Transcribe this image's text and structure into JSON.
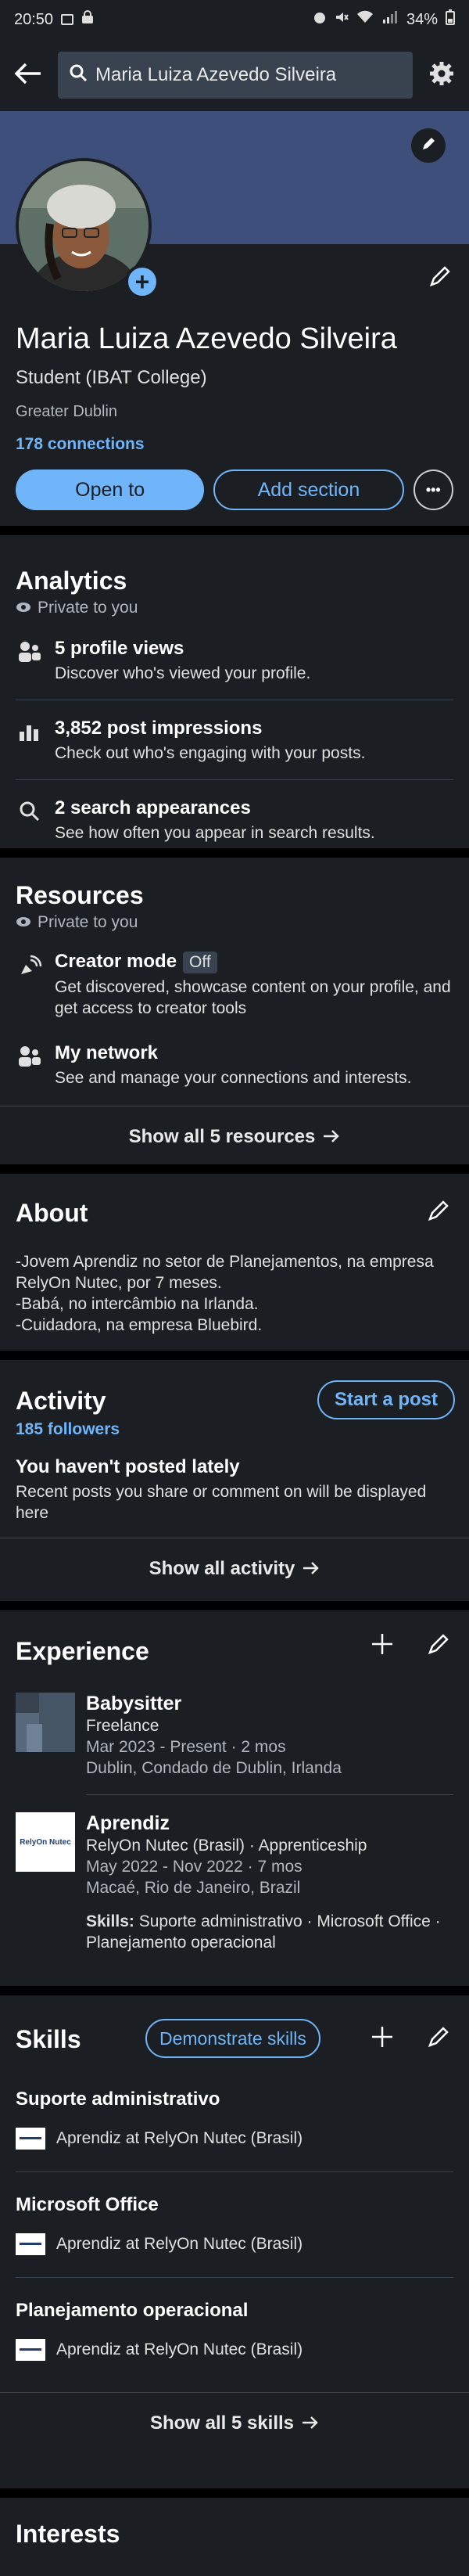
{
  "status_bar": {
    "time": "20:50",
    "battery": "34%"
  },
  "search": {
    "value": "Maria Luiza Azevedo Silveira"
  },
  "profile": {
    "name": "Maria Luiza Azevedo Silveira",
    "headline": "Student (IBAT College)",
    "location": "Greater Dublin",
    "connections": "178 connections",
    "open_to_label": "Open to",
    "add_section_label": "Add section",
    "more_label": "•••"
  },
  "analytics": {
    "title": "Analytics",
    "private": "Private to you",
    "items": [
      {
        "title": "5 profile views",
        "desc": "Discover who's viewed your profile."
      },
      {
        "title": "3,852 post impressions",
        "desc": "Check out who's engaging with your posts."
      },
      {
        "title": "2 search appearances",
        "desc": "See how often you appear in search results."
      }
    ]
  },
  "resources": {
    "title": "Resources",
    "private": "Private to you",
    "creator_title": "Creator mode",
    "creator_badge": "Off",
    "creator_desc": "Get discovered, showcase content on your profile, and get access to creator tools",
    "network_title": "My network",
    "network_desc": "See and manage your connections and interests.",
    "show_all": "Show all 5 resources"
  },
  "about": {
    "title": "About",
    "lines": [
      "-Jovem Aprendiz no setor de Planejamentos, na empresa",
      "RelyOn Nutec, por 7  meses.",
      "-Babá, no intercâmbio na Irlanda.",
      "-Cuidadora, na empresa Bluebird."
    ]
  },
  "activity": {
    "title": "Activity",
    "followers": "185 followers",
    "start_post": "Start a post",
    "empty_title": "You haven't posted lately",
    "empty_desc": "Recent posts you share or comment on will be displayed here",
    "show_all": "Show all activity"
  },
  "experience": {
    "title": "Experience",
    "items": [
      {
        "title": "Babysitter",
        "company": "Freelance",
        "dates": "Mar 2023 - Present · 2 mos",
        "location": "Dublin, Condado de Dublin, Irlanda"
      },
      {
        "title": "Aprendiz",
        "company": "RelyOn Nutec (Brasil) · Apprenticeship",
        "dates": "May 2022 - Nov 2022 · 7 mos",
        "location": "Macaé, Rio de Janeiro, Brazil",
        "skills_label": "Skills:",
        "skills": "Suporte administrativo · Microsoft Office · Planejamento operacional",
        "logo_text": "RelyOn Nutec"
      }
    ]
  },
  "skills": {
    "title": "Skills",
    "demonstrate": "Demonstrate skills",
    "items": [
      {
        "name": "Suporte administrativo",
        "context": "Aprendiz at RelyOn Nutec (Brasil)"
      },
      {
        "name": "Microsoft Office",
        "context": "Aprendiz at RelyOn Nutec (Brasil)"
      },
      {
        "name": "Planejamento operacional",
        "context": "Aprendiz at RelyOn Nutec (Brasil)"
      }
    ],
    "show_all": "Show all 5 skills"
  },
  "interests": {
    "title": "Interests"
  },
  "colors": {
    "accent": "#70b5f9",
    "card": "#1b1f23",
    "banner": "#3e4f7b"
  }
}
